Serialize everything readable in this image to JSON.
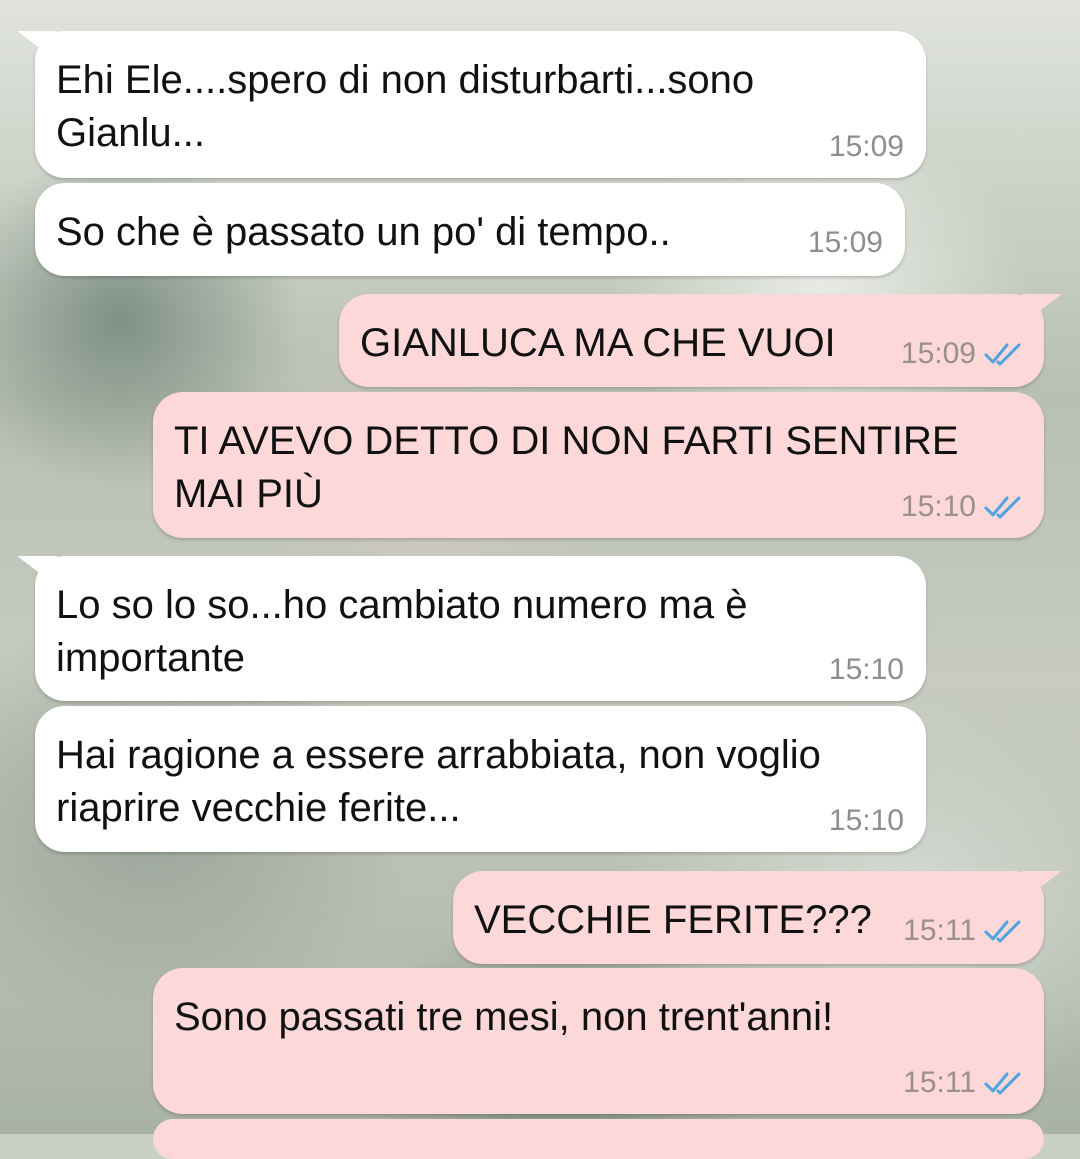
{
  "conversation": {
    "messages": [
      {
        "direction": "incoming",
        "text": "Ehi Ele....spero di non disturbarti...sono\nGianlu...",
        "time": "15:09"
      },
      {
        "direction": "incoming",
        "text": "So che è passato un po' di tempo..",
        "time": "15:09"
      },
      {
        "direction": "outgoing",
        "text": "GIANLUCA MA CHE VUOI",
        "time": "15:09",
        "status": "read"
      },
      {
        "direction": "outgoing",
        "text": "TI AVEVO DETTO DI NON FARTI SENTIRE\nMAI PIÙ",
        "time": "15:10",
        "status": "read"
      },
      {
        "direction": "incoming",
        "text": "Lo so lo so...ho cambiato numero ma è\nimportante",
        "time": "15:10"
      },
      {
        "direction": "incoming",
        "text": "Hai ragione a essere arrabbiata, non voglio\nriaprire vecchie ferite...",
        "time": "15:10"
      },
      {
        "direction": "outgoing",
        "text": "VECCHIE FERITE???",
        "time": "15:11",
        "status": "read"
      },
      {
        "direction": "outgoing",
        "text": "Sono passati tre mesi, non trent'anni!",
        "time": "15:11",
        "status": "read"
      }
    ]
  },
  "colors": {
    "incoming_bubble": "#ffffff",
    "outgoing_bubble": "#fdd8d8",
    "read_ticks": "#4fa3e0",
    "timestamp": "#8e8e8e"
  },
  "icons": {
    "read_status": "double-check-icon"
  }
}
